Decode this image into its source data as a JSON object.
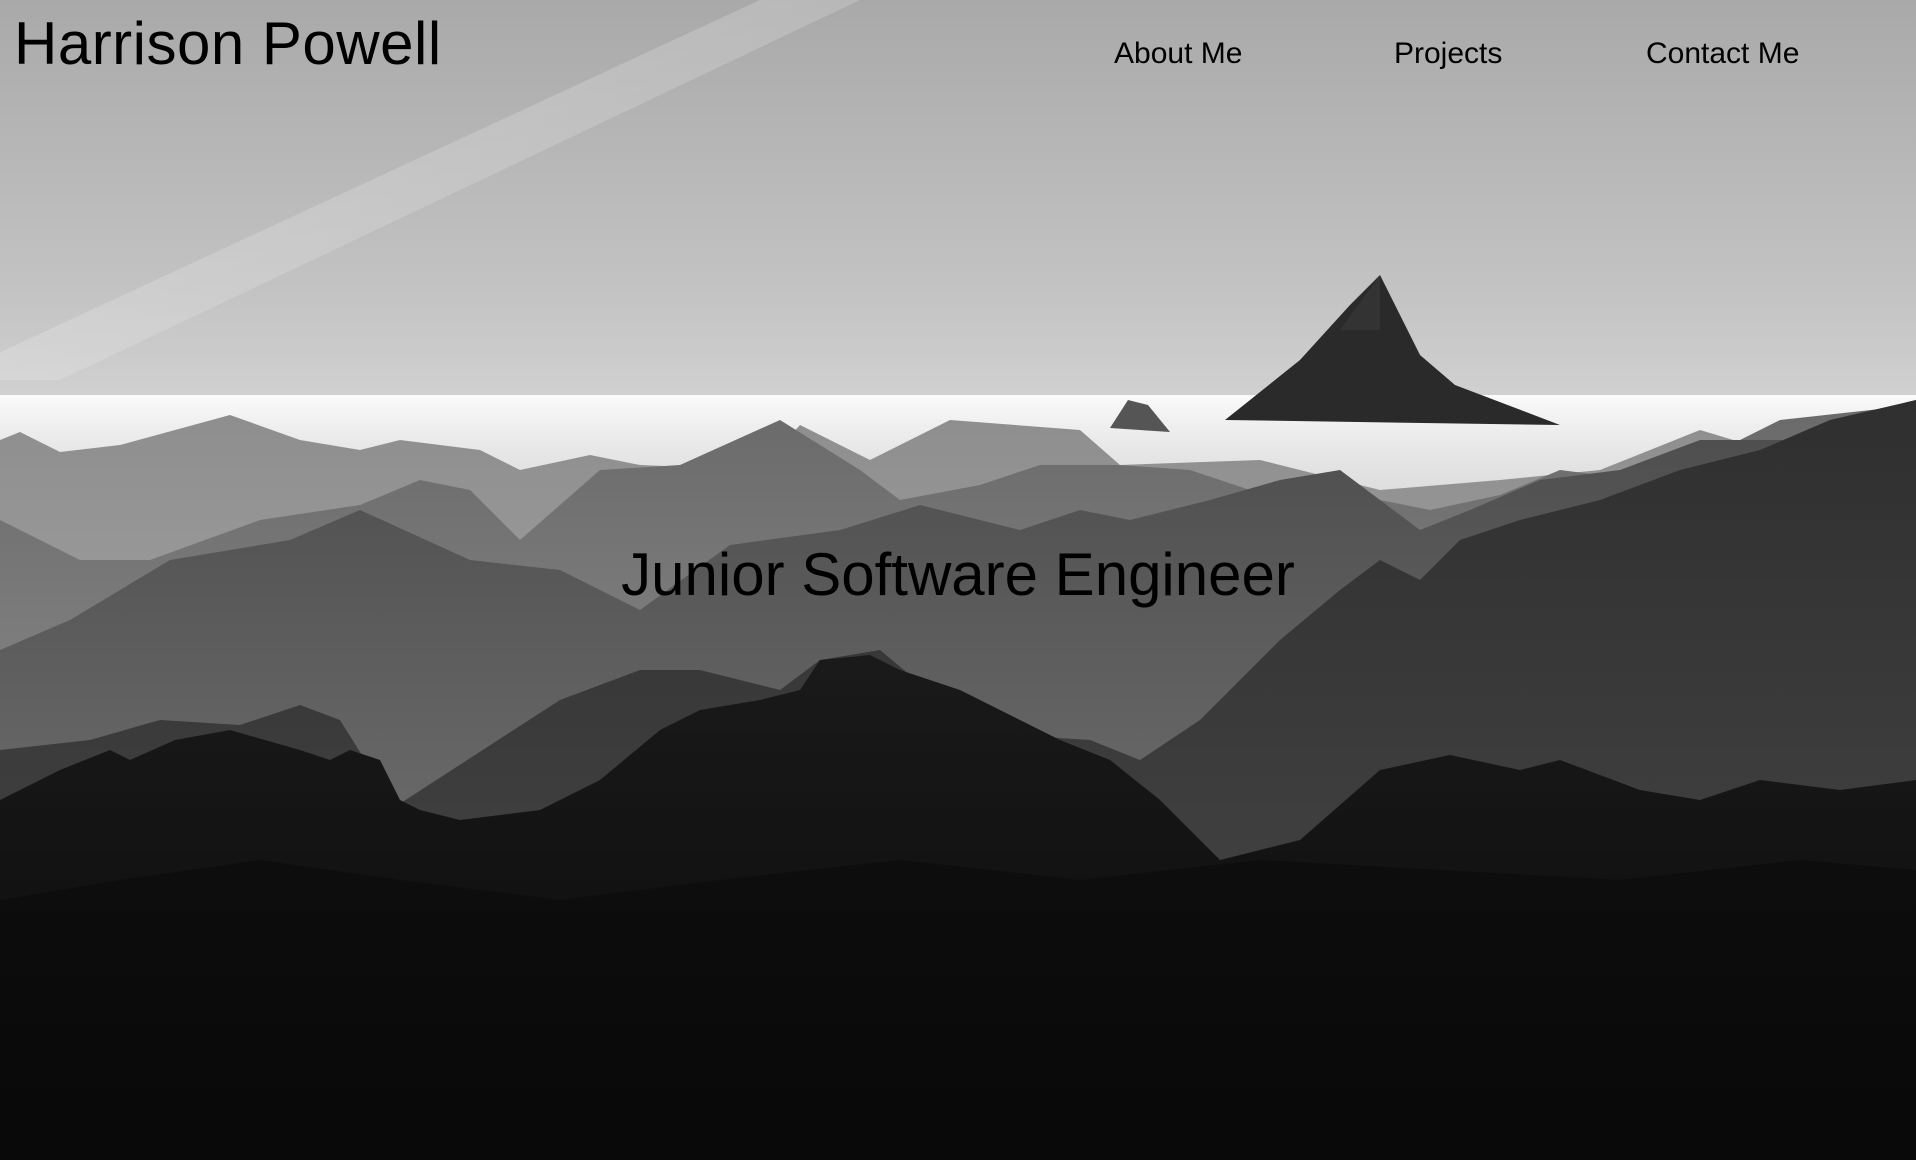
{
  "header": {
    "name": "Harrison Powell"
  },
  "nav": {
    "items": [
      {
        "label": "About Me"
      },
      {
        "label": "Projects"
      },
      {
        "label": "Contact Me"
      }
    ]
  },
  "hero": {
    "tagline": "Junior Software Engineer",
    "background": "black-and-white-mountain-range-photo",
    "colors": {
      "sky": "#c9c9c9",
      "text": "#000000"
    }
  }
}
